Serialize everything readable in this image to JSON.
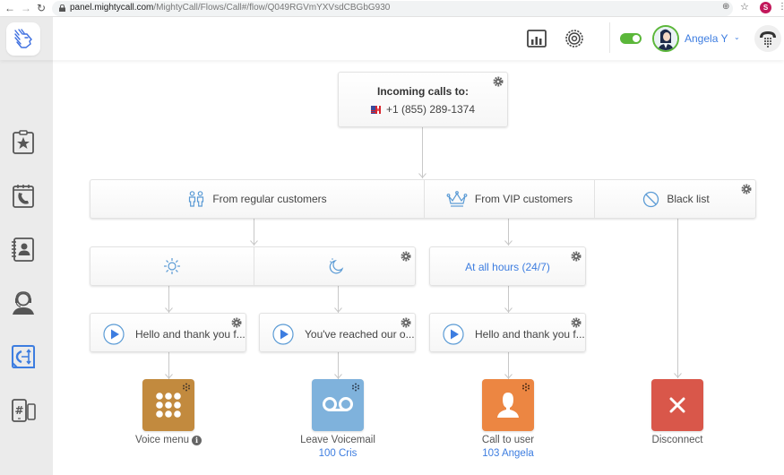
{
  "browser": {
    "back_icon": "arrow-left-icon",
    "forward_icon": "arrow-right-icon",
    "reload_icon": "reload-icon",
    "url_host": "panel.mightycall.com",
    "url_path": "/MightyCall/Flows/Call#/flow/Q049RGVmYXVsdCBGbG930",
    "profile_initial": "S"
  },
  "header": {
    "logo_icon": "mightycall-logo-icon",
    "reports_icon": "bar-chart-icon",
    "settings_icon": "gear-icon",
    "status_toggle": "on",
    "user_name": "Angela Y",
    "chevron": "⌄",
    "dialer_icon": "phone-dialpad-icon"
  },
  "sidebar": {
    "items": [
      {
        "name": "favorites",
        "icon": "clipboard-star-icon",
        "active": false
      },
      {
        "name": "calendar-calls",
        "icon": "calendar-phone-icon",
        "active": false
      },
      {
        "name": "contacts",
        "icon": "address-book-icon",
        "active": false
      },
      {
        "name": "operator",
        "icon": "headset-agent-icon",
        "active": false
      },
      {
        "name": "call-flows",
        "icon": "call-flow-icon",
        "active": true
      },
      {
        "name": "numbers",
        "icon": "phone-numbers-icon",
        "active": false
      }
    ]
  },
  "flow": {
    "incoming": {
      "title": "Incoming calls to:",
      "number": "+1 (855) 289-1374",
      "flag_icon": "us-ca-flag-icon"
    },
    "filters": [
      {
        "label": "From regular customers",
        "icon": "people-icon"
      },
      {
        "label": "From VIP customers",
        "icon": "crown-icon"
      },
      {
        "label": "Black list",
        "icon": "block-icon"
      }
    ],
    "schedules": {
      "regular": [
        {
          "icon": "sun-icon",
          "label": ""
        },
        {
          "icon": "moon-icon",
          "label": ""
        }
      ],
      "vip": {
        "label": "At all hours (24/7)"
      }
    },
    "greetings": [
      {
        "text": "Hello and thank you f...",
        "icon": "play-icon"
      },
      {
        "text": "You've reached our o...",
        "icon": "play-icon"
      },
      {
        "text": "Hello and thank you f...",
        "icon": "play-icon"
      }
    ],
    "actions": [
      {
        "label": "Voice menu",
        "sub": "",
        "icon": "keypad-icon",
        "color": "#c28a3e",
        "info": "i"
      },
      {
        "label": "Leave Voicemail",
        "sub": "100 Cris",
        "icon": "voicemail-icon",
        "color": "#7fb2dc"
      },
      {
        "label": "Call to user",
        "sub": "103 Angela",
        "icon": "user-icon",
        "color": "#ec8642"
      },
      {
        "label": "Disconnect",
        "sub": "",
        "icon": "close-icon",
        "color": "#d9574a"
      }
    ]
  },
  "colors": {
    "accent": "#3d7de0",
    "status_green": "#5bb73a",
    "connector": "#c8c8c8"
  }
}
